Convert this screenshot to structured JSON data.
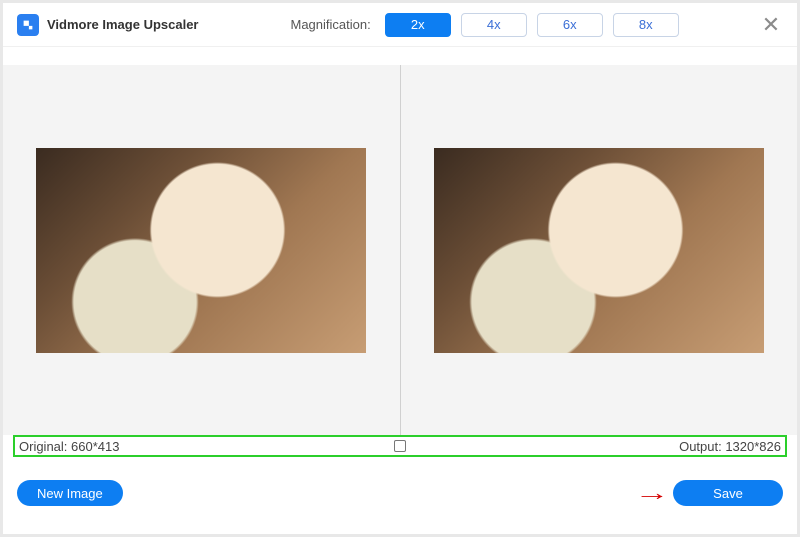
{
  "app": {
    "title": "Vidmore Image Upscaler"
  },
  "magnification": {
    "label": "Magnification:",
    "options": [
      "2x",
      "4x",
      "6x",
      "8x"
    ],
    "selected_index": 0
  },
  "dimensions": {
    "original_label": "Original: 660*413",
    "output_label": "Output: 1320*826"
  },
  "buttons": {
    "new_image": "New Image",
    "save": "Save"
  },
  "colors": {
    "accent": "#0d7ef2",
    "highlight_border": "#2bcf2b",
    "arrow": "#d40000"
  }
}
